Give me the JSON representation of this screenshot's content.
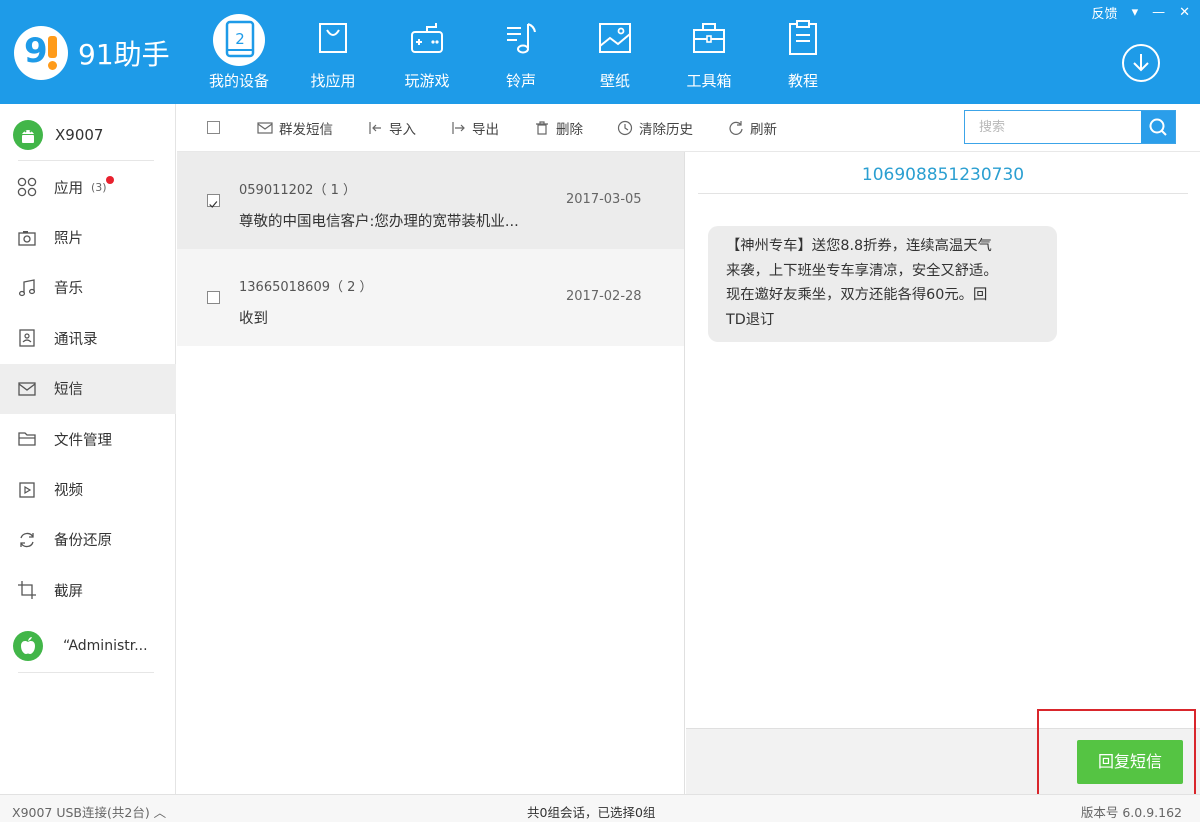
{
  "app": {
    "logo_text": "91助手"
  },
  "window": {
    "feedback": "反馈",
    "menu_glyph": "▾",
    "minimize_glyph": "—",
    "close_glyph": "✕"
  },
  "nav": {
    "items": [
      {
        "label": "我的设备",
        "icon": "device-icon",
        "active": true,
        "badge_num": "2"
      },
      {
        "label": "找应用",
        "icon": "shopping-bag-icon"
      },
      {
        "label": "玩游戏",
        "icon": "gamepad-icon"
      },
      {
        "label": "铃声",
        "icon": "music-note-icon"
      },
      {
        "label": "壁纸",
        "icon": "wallpaper-icon"
      },
      {
        "label": "工具箱",
        "icon": "toolbox-icon"
      },
      {
        "label": "教程",
        "icon": "clipboard-icon"
      }
    ],
    "download_icon": "download-icon"
  },
  "sidebar": {
    "device_name": "X9007",
    "items": [
      {
        "label": "应用",
        "icon": "apps-icon",
        "badge": "(3)"
      },
      {
        "label": "照片",
        "icon": "camera-icon"
      },
      {
        "label": "音乐",
        "icon": "music-icon"
      },
      {
        "label": "通讯录",
        "icon": "contacts-icon"
      },
      {
        "label": "短信",
        "icon": "sms-icon",
        "active": true
      },
      {
        "label": "文件管理",
        "icon": "folder-icon"
      },
      {
        "label": "视频",
        "icon": "video-icon"
      },
      {
        "label": "备份还原",
        "icon": "backup-icon"
      },
      {
        "label": "截屏",
        "icon": "crop-icon"
      }
    ],
    "other_device": "“Administr..."
  },
  "toolbar": {
    "group_sms": "群发短信",
    "import": "导入",
    "export": "导出",
    "delete": "删除",
    "clear_history": "清除历史",
    "refresh": "刷新",
    "search_placeholder": "搜索"
  },
  "conversations": [
    {
      "number": "059011202（ 1 ）",
      "date": "2017-03-05",
      "preview": "尊敬的中国电信客户:您办理的宽带装机业...",
      "checked": true,
      "selected": true
    },
    {
      "number": "13665018609（ 2 ）",
      "date": "2017-02-28",
      "preview": "收到",
      "checked": false,
      "selected": false
    }
  ],
  "message": {
    "title": "106908851230730",
    "bubble_lines": [
      "【神州专车】送您8.8折券，连续高温天气",
      "来袭，上下班坐专车享清凉，安全又舒适。",
      "现在邀好友乘坐，双方还能各得60元。回",
      "TD退订"
    ],
    "reply_button": "回复短信"
  },
  "status": {
    "connection": "X9007 USB连接(共2台) ︿",
    "summary": "共0组会话，已选择0组",
    "version": "版本号 6.0.9.162"
  },
  "colors": {
    "brand_blue": "#1e9be8",
    "reply_green": "#55c443",
    "highlight_red": "#d9262c",
    "title_teal": "#2b9fd1"
  }
}
